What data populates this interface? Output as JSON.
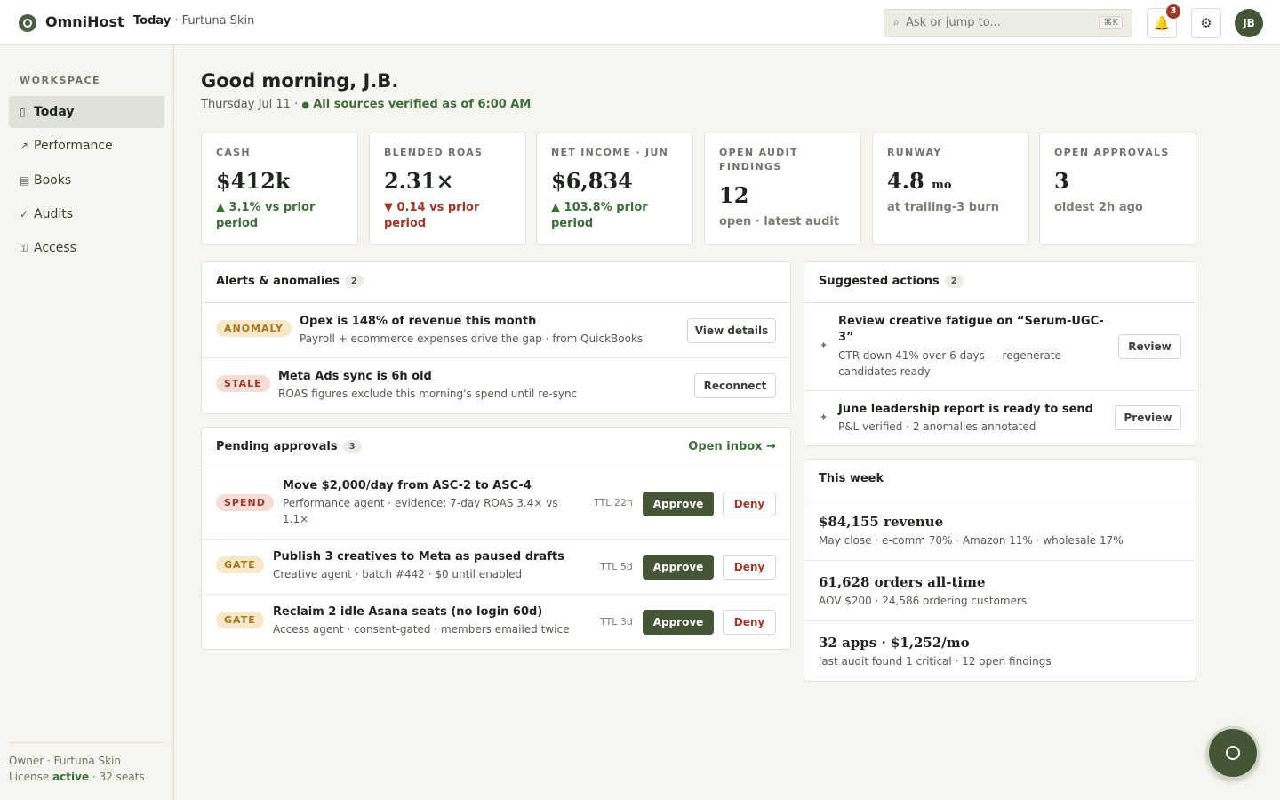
{
  "topbar": {
    "app_name": "OmniHost",
    "crumb_current": "Today",
    "crumb_sep": "·",
    "crumb_org": "Furtuna Skin",
    "search_placeholder": "Ask or jump to...",
    "search_shortcut": "⌘K",
    "notification_count": "3",
    "avatar_initials": "JB",
    "icons": {
      "search": "search-icon",
      "notifications": "bell-icon",
      "settings": "gear-icon"
    }
  },
  "sidebar": {
    "section_label": "WORKSPACE",
    "items": [
      {
        "label": "Today",
        "icon": "▯",
        "active": true
      },
      {
        "label": "Performance",
        "icon": "↗",
        "active": false
      },
      {
        "label": "Books",
        "icon": "▤",
        "active": false
      },
      {
        "label": "Audits",
        "icon": "✓",
        "active": false
      },
      {
        "label": "Access",
        "icon": "⚿",
        "active": false
      }
    ],
    "footer": {
      "role_line": "Owner · Furtuna Skin",
      "license_prefix": "License",
      "license_status": "active",
      "license_suffix": "· 32 seats"
    }
  },
  "header": {
    "greeting": "Good morning, J.B.",
    "date": "Thursday Jul 11 ·",
    "status_dot": "●",
    "verified": "All sources verified as of 6:00 AM"
  },
  "kpis": [
    {
      "label": "CASH",
      "value": "$412k",
      "unit": "",
      "delta": "▲ 3.1% vs prior period",
      "trend": "up"
    },
    {
      "label": "BLENDED ROAS",
      "value": "2.31×",
      "unit": "",
      "delta": "▼ 0.14 vs prior period",
      "trend": "down"
    },
    {
      "label": "NET INCOME · JUN",
      "value": "$6,834",
      "unit": "",
      "delta": "▲ 103.8% prior period",
      "trend": "up"
    },
    {
      "label": "OPEN AUDIT FINDINGS",
      "value": "12",
      "unit": "",
      "delta": "open · latest audit",
      "trend": "neutral"
    },
    {
      "label": "RUNWAY",
      "value": "4.8",
      "unit": "mo",
      "delta": "at trailing-3 burn",
      "trend": "neutral"
    },
    {
      "label": "OPEN APPROVALS",
      "value": "3",
      "unit": "",
      "delta": "oldest 2h ago",
      "trend": "neutral"
    }
  ],
  "alerts": {
    "title": "Alerts & anomalies",
    "count": "2",
    "items": [
      {
        "tag": "ANOMALY",
        "title": "Opex is 148% of revenue this month",
        "sub": "Payroll + ecommerce expenses drive the gap · from QuickBooks",
        "action": "View details"
      },
      {
        "tag": "STALE",
        "title": "Meta Ads sync is 6h old",
        "sub": "ROAS figures exclude this morning's spend until re-sync",
        "action": "Reconnect"
      }
    ]
  },
  "approvals": {
    "title": "Pending approvals",
    "count": "3",
    "open_inbox": "Open inbox →",
    "approve_label": "Approve",
    "deny_label": "Deny",
    "items": [
      {
        "tag": "SPEND",
        "title": "Move $2,000/day from ASC-2 to ASC-4",
        "sub": "Performance agent · evidence: 7-day ROAS 3.4× vs 1.1×",
        "ttl": "TTL 22h"
      },
      {
        "tag": "GATE",
        "title": "Publish 3 creatives to Meta as paused drafts",
        "sub": "Creative agent · batch #442 · $0 until enabled",
        "ttl": "TTL 5d"
      },
      {
        "tag": "GATE",
        "title": "Reclaim 2 idle Asana seats (no login 60d)",
        "sub": "Access agent · consent-gated · members emailed twice",
        "ttl": "TTL 3d"
      }
    ]
  },
  "suggested": {
    "title": "Suggested actions",
    "count": "2",
    "items": [
      {
        "icon": "✦",
        "title": "Review creative fatigue on “Serum-UGC-3”",
        "sub": "CTR down 41% over 6 days — regenerate candidates ready",
        "action": "Review"
      },
      {
        "icon": "✦",
        "title": "June leadership report is ready to send",
        "sub": "P&L verified · 2 anomalies annotated",
        "action": "Preview"
      }
    ]
  },
  "week": {
    "title": "This week",
    "items": [
      {
        "title": "$84,155 revenue",
        "sub": "May close · e-comm 70% · Amazon 11% · wholesale 17%"
      },
      {
        "title": "61,628 orders all-time",
        "sub": "AOV $200 · 24,586 ordering customers"
      },
      {
        "title": "32 apps · $1,252/mo",
        "sub": "last audit found 1 critical · 12 open findings"
      }
    ]
  },
  "colors": {
    "brand": "#445538",
    "positive": "#3e6d3b",
    "negative": "#9b3a2c",
    "warning": "#a8761e",
    "background": "#f7f5ef"
  }
}
